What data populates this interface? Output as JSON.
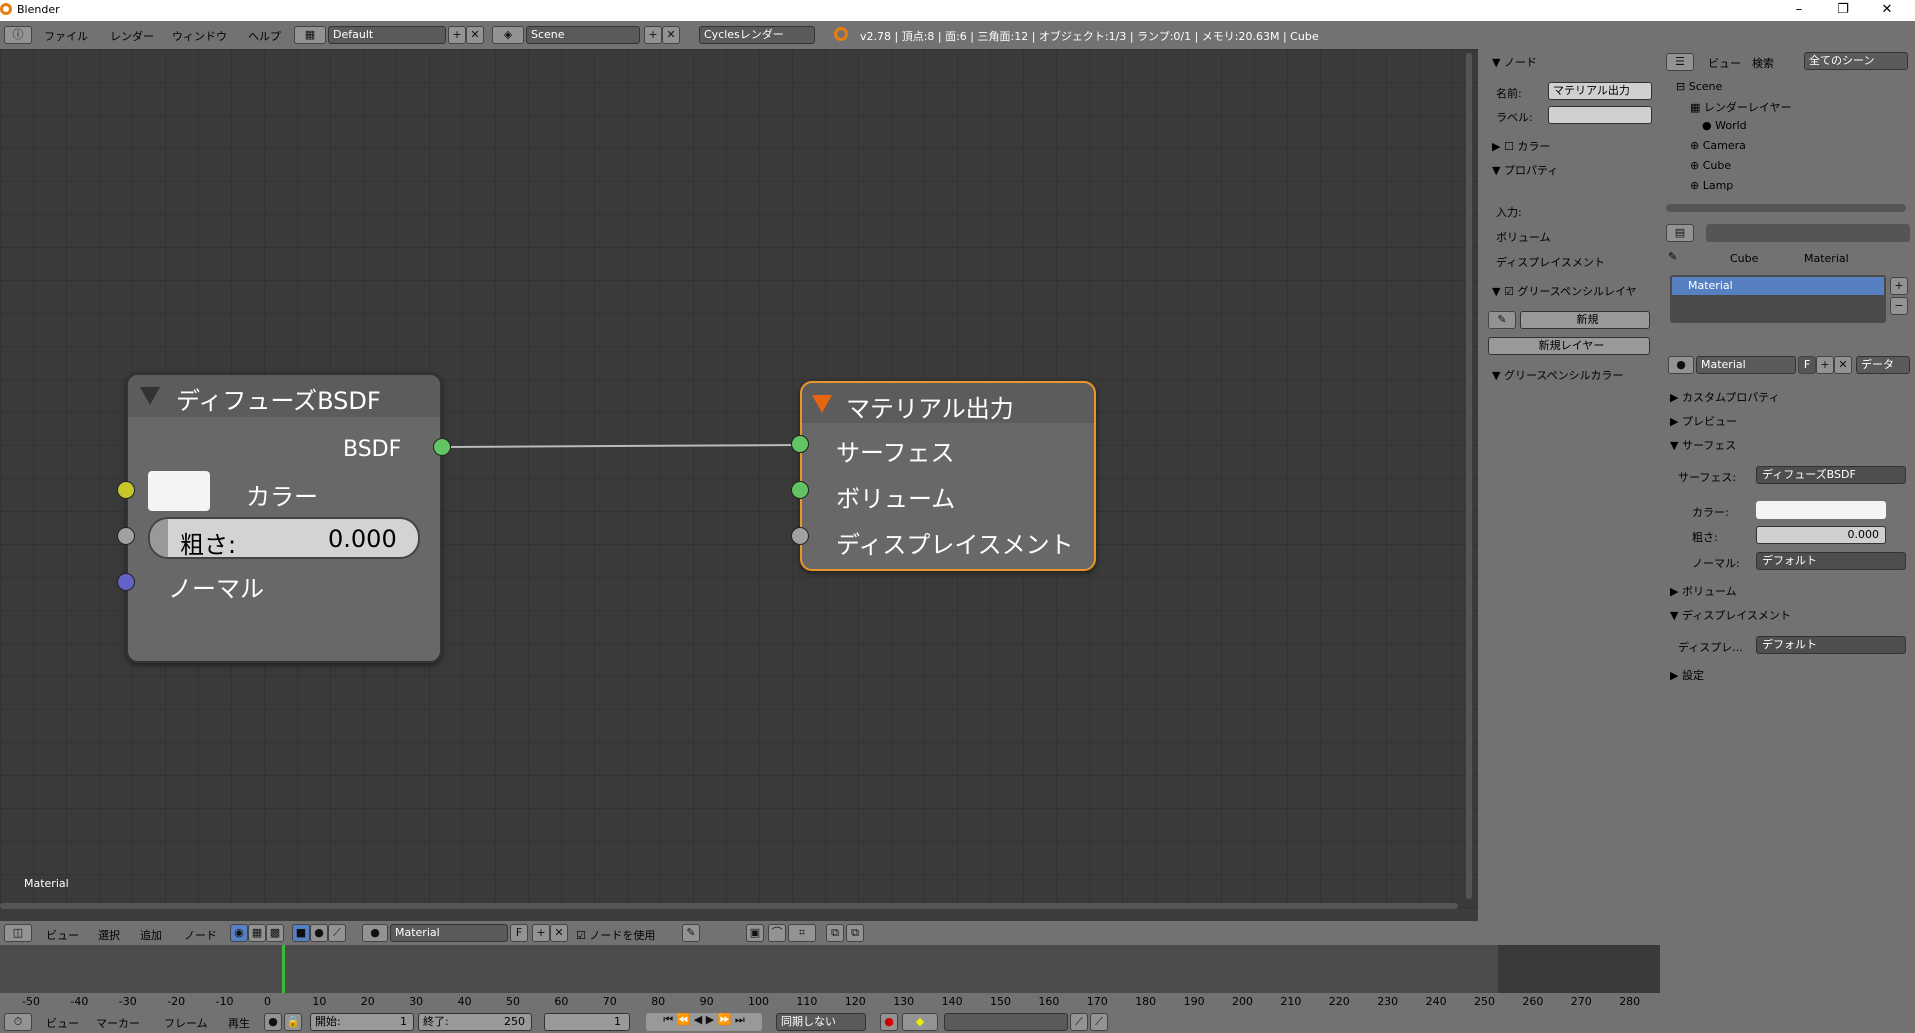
{
  "window": {
    "title": "Blender",
    "min": "–",
    "max": "❐",
    "close": "✕"
  },
  "topbar": {
    "menus": [
      "ファイル",
      "レンダー",
      "ウィンドウ",
      "ヘルプ"
    ],
    "layout": "Default",
    "scene": "Scene",
    "engine": "Cyclesレンダー",
    "stats": "v2.78 | 頂点:8 | 面:6 | 三角面:12 | オブジェクト:1/3 | ランプ:0/1 | メモリ:20.63M | Cube"
  },
  "node_diffuse": {
    "title": "ディフューズBSDF",
    "output": "BSDF",
    "color": "カラー",
    "rough_label": "粗さ:",
    "rough_value": "0.000",
    "normal": "ノーマル"
  },
  "node_output": {
    "title": "マテリアル出力",
    "surface": "サーフェス",
    "volume": "ボリューム",
    "displacement": "ディスプレイスメント"
  },
  "editor": {
    "material_label": "Material"
  },
  "npanel": {
    "node_header": "ノード",
    "name_label": "名前:",
    "name_value": "マテリアル出力",
    "label_label": "ラベル:",
    "color_header": "カラー",
    "props_header": "プロパティ",
    "input": "入力:",
    "volume": "ボリューム",
    "displacement": "ディスプレイスメント",
    "gp_layer": "グリースペンシルレイヤ",
    "new": "新規",
    "new_layer": "新規レイヤー",
    "gp_color": "グリースペンシルカラー"
  },
  "outliner": {
    "view": "ビュー",
    "search": "検索",
    "all_scenes": "全てのシーン",
    "items": [
      "Scene",
      "レンダーレイヤー",
      "World",
      "Camera",
      "Cube",
      "Lamp"
    ]
  },
  "props": {
    "crumb_obj": "Cube",
    "crumb_mat": "Material",
    "slot": "Material",
    "mat_name": "Material",
    "f": "F",
    "data": "データ",
    "custom": "カスタムプロパティ",
    "preview": "プレビュー",
    "surface": "サーフェス",
    "surface_label": "サーフェス:",
    "surface_value": "ディフューズBSDF",
    "color_label": "カラー:",
    "rough_label": "粗さ:",
    "rough_value": "0.000",
    "normal_label": "ノーマル:",
    "normal_value": "デフォルト",
    "volume": "ボリューム",
    "displacement": "ディスプレイスメント",
    "disp_label": "ディスプレ...",
    "disp_value": "デフォルト",
    "settings": "設定"
  },
  "nodebar": {
    "menus": [
      "ビュー",
      "選択",
      "追加",
      "ノード"
    ],
    "material": "Material",
    "f": "F",
    "use_nodes": "ノードを使用"
  },
  "ruler": [
    "-50",
    "-40",
    "-30",
    "-20",
    "-10",
    "0",
    "10",
    "20",
    "30",
    "40",
    "50",
    "60",
    "70",
    "80",
    "90",
    "100",
    "110",
    "120",
    "130",
    "140",
    "150",
    "160",
    "170",
    "180",
    "190",
    "200",
    "210",
    "220",
    "230",
    "240",
    "250",
    "260",
    "270",
    "280"
  ],
  "tlbar": {
    "menus": [
      "ビュー",
      "マーカー",
      "フレーム",
      "再生"
    ],
    "start_label": "開始:",
    "start": "1",
    "end_label": "終了:",
    "end": "250",
    "current": "1",
    "sync": "同期しない"
  }
}
